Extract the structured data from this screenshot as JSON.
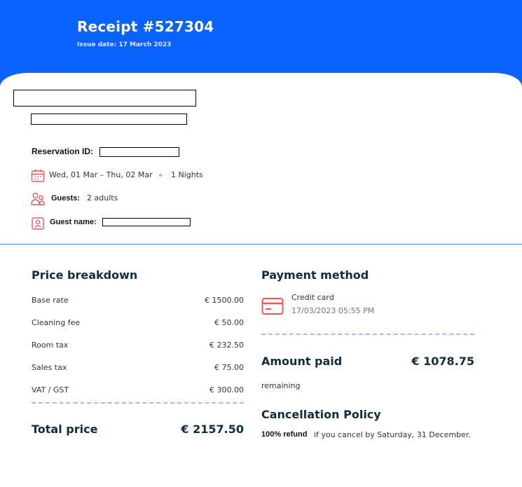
{
  "header": {
    "title": "Receipt #527304",
    "issue_date": "Issue date: 17 March 2023"
  },
  "reservation": {
    "id_label": "Reservation ID:",
    "dates": "Wed, 01 Mar – Thu, 02 Mar",
    "nights": "1 Nights",
    "guests_label": "Guests:",
    "guests_value": "2 adults",
    "guest_name_label": "Guest name:"
  },
  "price_breakdown": {
    "title": "Price breakdown",
    "items": [
      {
        "label": "Base rate",
        "amount": "€ 1500.00"
      },
      {
        "label": "Cleaning fee",
        "amount": "€ 50.00"
      },
      {
        "label": "Room tax",
        "amount": "€ 232.50"
      },
      {
        "label": "Sales tax",
        "amount": "€ 75.00"
      },
      {
        "label": "VAT / GST",
        "amount": "€ 300.00"
      }
    ],
    "total_label": "Total price",
    "total_value": "€ 2157.50"
  },
  "payment": {
    "title": "Payment method",
    "method": "Credit card",
    "datetime": "17/03/2023 05:55 PM",
    "amount_paid_label": "Amount paid",
    "amount_paid_value": "€ 1078.75",
    "remaining": "remaining"
  },
  "cancellation": {
    "title": "Cancellation Policy",
    "refund_bold": "100% refund",
    "refund_text": "if you cancel by Saturday, 31 December."
  },
  "colors": {
    "header_blue": "#0b63ff",
    "dark_heading": "#0f2d3a",
    "icon_red": "#e85a5a",
    "dash_blue": "#9fbef5"
  },
  "icons": [
    "calendar-icon",
    "guests-icon",
    "guest-name-icon",
    "credit-card-icon"
  ]
}
